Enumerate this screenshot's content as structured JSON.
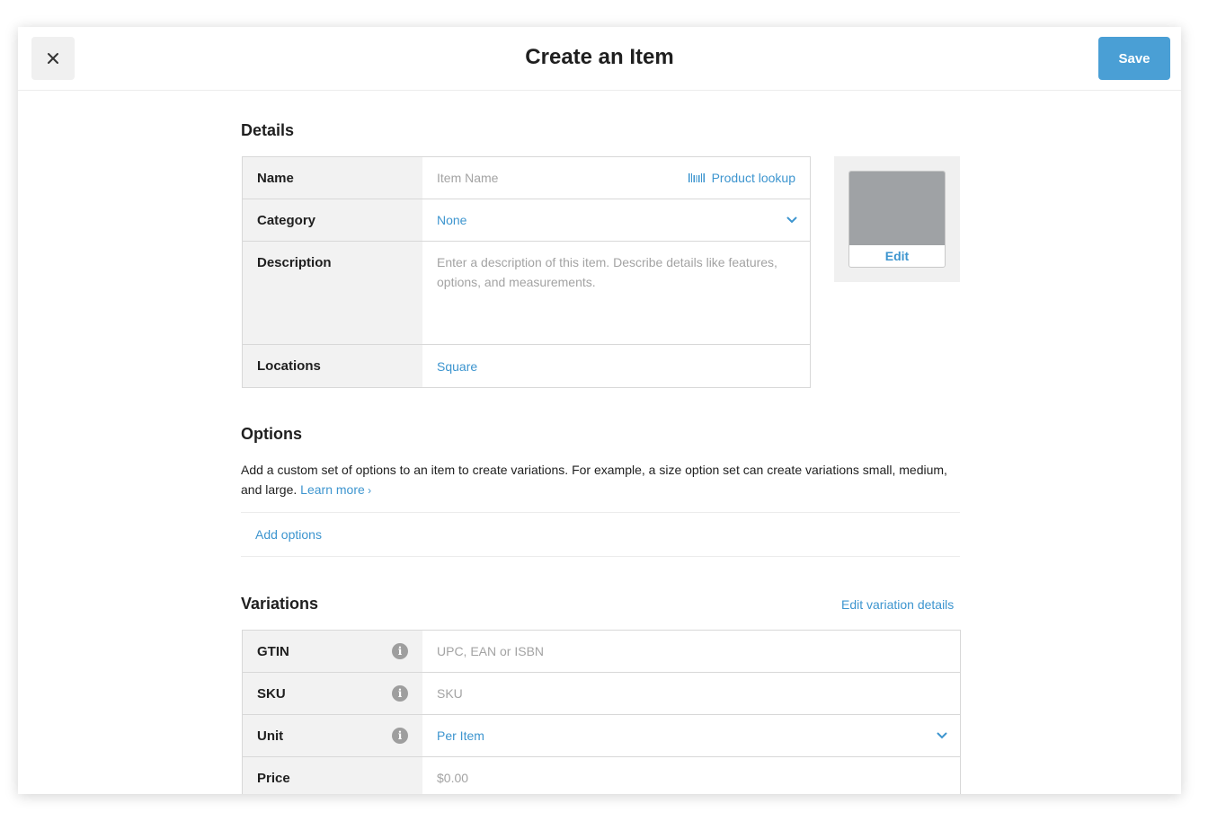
{
  "header": {
    "title": "Create an Item",
    "save_label": "Save"
  },
  "details": {
    "title": "Details",
    "name_label": "Name",
    "name_placeholder": "Item Name",
    "product_lookup": "Product lookup",
    "category_label": "Category",
    "category_value": "None",
    "description_label": "Description",
    "description_placeholder": "Enter a description of this item. Describe details like features, options, and measurements.",
    "locations_label": "Locations",
    "locations_value": "Square",
    "image_edit": "Edit"
  },
  "options": {
    "title": "Options",
    "description": "Add a custom set of options to an item to create variations. For example, a size option set can create variations small, medium, and large.",
    "learn_more": "Learn more",
    "add_options": "Add options"
  },
  "variations": {
    "title": "Variations",
    "edit_details": "Edit variation details",
    "rows": [
      {
        "label": "GTIN",
        "placeholder": "UPC, EAN or ISBN"
      },
      {
        "label": "SKU",
        "placeholder": "SKU"
      },
      {
        "label": "Unit",
        "value": "Per Item"
      },
      {
        "label": "Price",
        "placeholder": "$0.00"
      }
    ]
  },
  "icons": {
    "close": "close-icon",
    "barcode": "barcode-icon",
    "chevron": "chevron-down-icon",
    "info": "info-icon"
  },
  "colors": {
    "accent": "#4a9fd5",
    "link": "#3d95cf",
    "label_bg": "#f2f2f2"
  }
}
